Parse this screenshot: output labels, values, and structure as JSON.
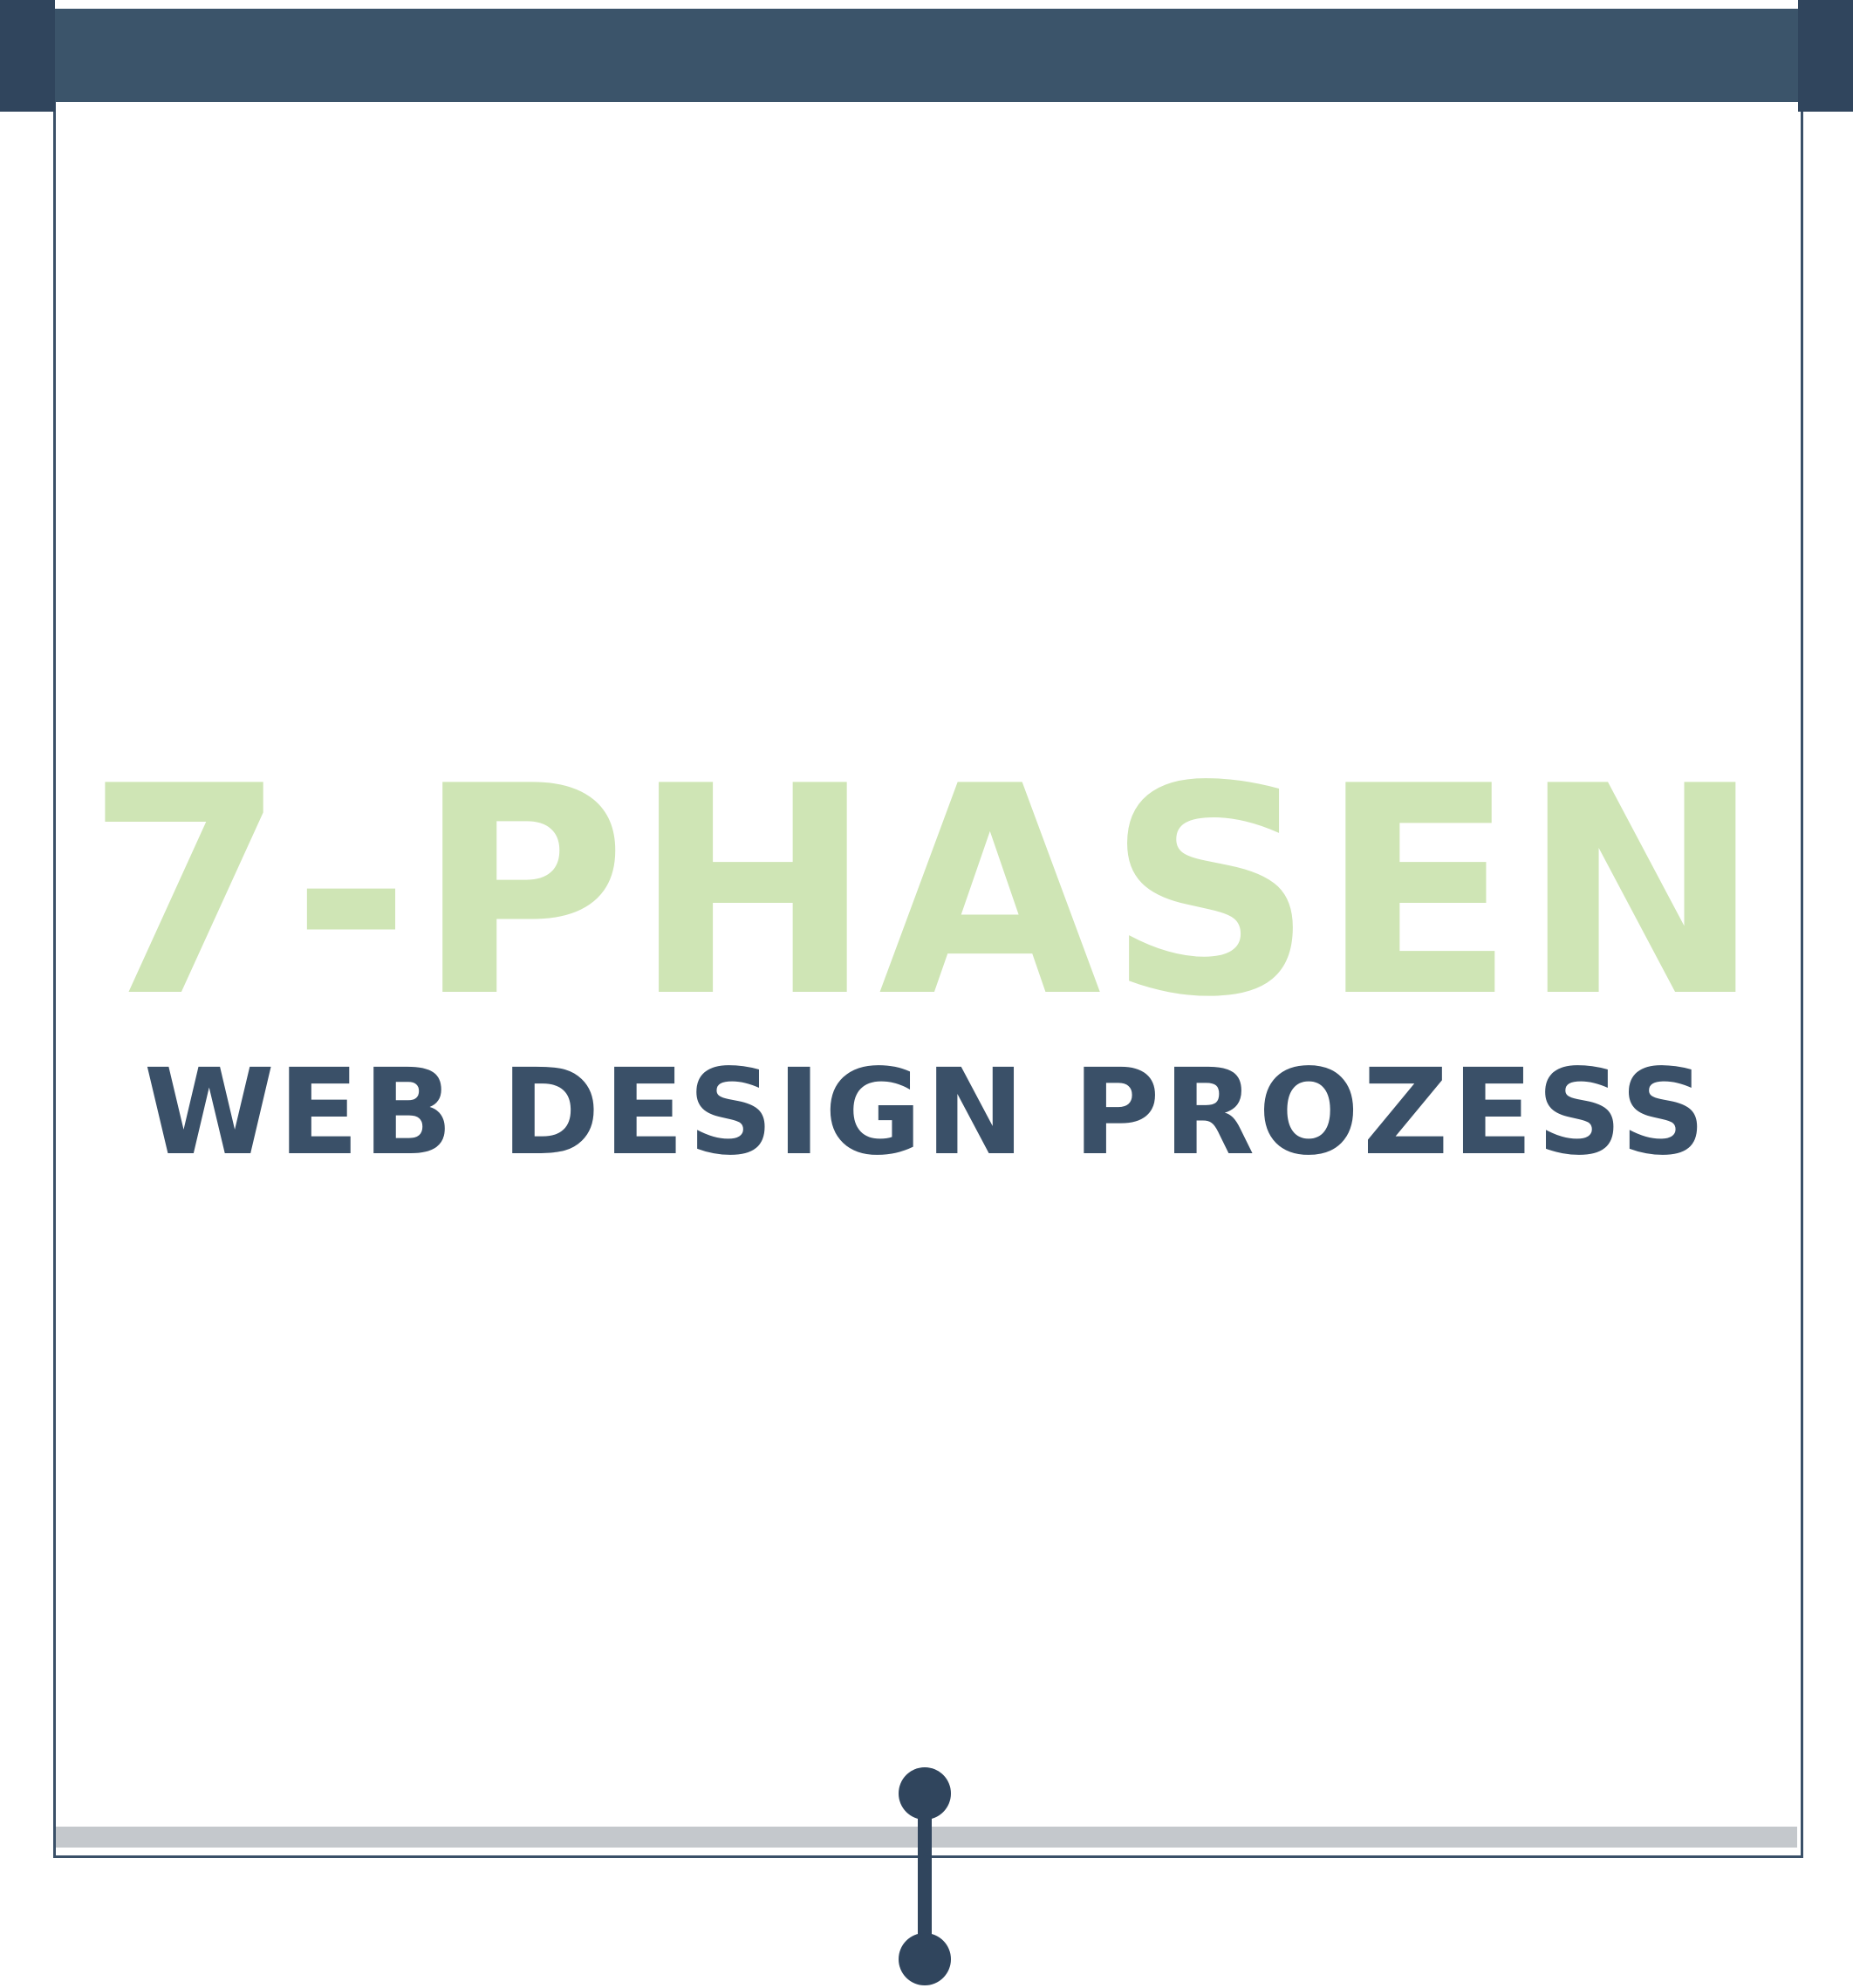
{
  "banner": {
    "title": "7-PHASEN",
    "subtitle": "WEB DESIGN PROZESS"
  },
  "colors": {
    "roller_bar": "#3b546a",
    "roller_cap": "#30455d",
    "screen_border": "#3a5068",
    "title": "#cfe5b5",
    "subtitle": "#3a5068",
    "bottom_rail": "#c4c8cc",
    "cord": "#30455d"
  }
}
